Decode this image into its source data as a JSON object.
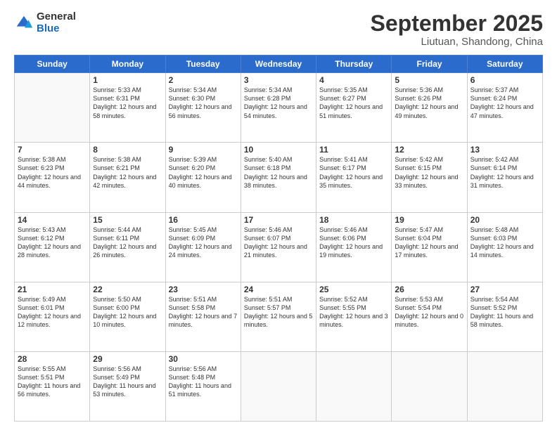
{
  "logo": {
    "general": "General",
    "blue": "Blue"
  },
  "header": {
    "month": "September 2025",
    "location": "Liutuan, Shandong, China"
  },
  "weekdays": [
    "Sunday",
    "Monday",
    "Tuesday",
    "Wednesday",
    "Thursday",
    "Friday",
    "Saturday"
  ],
  "weeks": [
    [
      {
        "day": "",
        "sunrise": "",
        "sunset": "",
        "daylight": ""
      },
      {
        "day": "1",
        "sunrise": "Sunrise: 5:33 AM",
        "sunset": "Sunset: 6:31 PM",
        "daylight": "Daylight: 12 hours and 58 minutes."
      },
      {
        "day": "2",
        "sunrise": "Sunrise: 5:34 AM",
        "sunset": "Sunset: 6:30 PM",
        "daylight": "Daylight: 12 hours and 56 minutes."
      },
      {
        "day": "3",
        "sunrise": "Sunrise: 5:34 AM",
        "sunset": "Sunset: 6:28 PM",
        "daylight": "Daylight: 12 hours and 54 minutes."
      },
      {
        "day": "4",
        "sunrise": "Sunrise: 5:35 AM",
        "sunset": "Sunset: 6:27 PM",
        "daylight": "Daylight: 12 hours and 51 minutes."
      },
      {
        "day": "5",
        "sunrise": "Sunrise: 5:36 AM",
        "sunset": "Sunset: 6:26 PM",
        "daylight": "Daylight: 12 hours and 49 minutes."
      },
      {
        "day": "6",
        "sunrise": "Sunrise: 5:37 AM",
        "sunset": "Sunset: 6:24 PM",
        "daylight": "Daylight: 12 hours and 47 minutes."
      }
    ],
    [
      {
        "day": "7",
        "sunrise": "Sunrise: 5:38 AM",
        "sunset": "Sunset: 6:23 PM",
        "daylight": "Daylight: 12 hours and 44 minutes."
      },
      {
        "day": "8",
        "sunrise": "Sunrise: 5:38 AM",
        "sunset": "Sunset: 6:21 PM",
        "daylight": "Daylight: 12 hours and 42 minutes."
      },
      {
        "day": "9",
        "sunrise": "Sunrise: 5:39 AM",
        "sunset": "Sunset: 6:20 PM",
        "daylight": "Daylight: 12 hours and 40 minutes."
      },
      {
        "day": "10",
        "sunrise": "Sunrise: 5:40 AM",
        "sunset": "Sunset: 6:18 PM",
        "daylight": "Daylight: 12 hours and 38 minutes."
      },
      {
        "day": "11",
        "sunrise": "Sunrise: 5:41 AM",
        "sunset": "Sunset: 6:17 PM",
        "daylight": "Daylight: 12 hours and 35 minutes."
      },
      {
        "day": "12",
        "sunrise": "Sunrise: 5:42 AM",
        "sunset": "Sunset: 6:15 PM",
        "daylight": "Daylight: 12 hours and 33 minutes."
      },
      {
        "day": "13",
        "sunrise": "Sunrise: 5:42 AM",
        "sunset": "Sunset: 6:14 PM",
        "daylight": "Daylight: 12 hours and 31 minutes."
      }
    ],
    [
      {
        "day": "14",
        "sunrise": "Sunrise: 5:43 AM",
        "sunset": "Sunset: 6:12 PM",
        "daylight": "Daylight: 12 hours and 28 minutes."
      },
      {
        "day": "15",
        "sunrise": "Sunrise: 5:44 AM",
        "sunset": "Sunset: 6:11 PM",
        "daylight": "Daylight: 12 hours and 26 minutes."
      },
      {
        "day": "16",
        "sunrise": "Sunrise: 5:45 AM",
        "sunset": "Sunset: 6:09 PM",
        "daylight": "Daylight: 12 hours and 24 minutes."
      },
      {
        "day": "17",
        "sunrise": "Sunrise: 5:46 AM",
        "sunset": "Sunset: 6:07 PM",
        "daylight": "Daylight: 12 hours and 21 minutes."
      },
      {
        "day": "18",
        "sunrise": "Sunrise: 5:46 AM",
        "sunset": "Sunset: 6:06 PM",
        "daylight": "Daylight: 12 hours and 19 minutes."
      },
      {
        "day": "19",
        "sunrise": "Sunrise: 5:47 AM",
        "sunset": "Sunset: 6:04 PM",
        "daylight": "Daylight: 12 hours and 17 minutes."
      },
      {
        "day": "20",
        "sunrise": "Sunrise: 5:48 AM",
        "sunset": "Sunset: 6:03 PM",
        "daylight": "Daylight: 12 hours and 14 minutes."
      }
    ],
    [
      {
        "day": "21",
        "sunrise": "Sunrise: 5:49 AM",
        "sunset": "Sunset: 6:01 PM",
        "daylight": "Daylight: 12 hours and 12 minutes."
      },
      {
        "day": "22",
        "sunrise": "Sunrise: 5:50 AM",
        "sunset": "Sunset: 6:00 PM",
        "daylight": "Daylight: 12 hours and 10 minutes."
      },
      {
        "day": "23",
        "sunrise": "Sunrise: 5:51 AM",
        "sunset": "Sunset: 5:58 PM",
        "daylight": "Daylight: 12 hours and 7 minutes."
      },
      {
        "day": "24",
        "sunrise": "Sunrise: 5:51 AM",
        "sunset": "Sunset: 5:57 PM",
        "daylight": "Daylight: 12 hours and 5 minutes."
      },
      {
        "day": "25",
        "sunrise": "Sunrise: 5:52 AM",
        "sunset": "Sunset: 5:55 PM",
        "daylight": "Daylight: 12 hours and 3 minutes."
      },
      {
        "day": "26",
        "sunrise": "Sunrise: 5:53 AM",
        "sunset": "Sunset: 5:54 PM",
        "daylight": "Daylight: 12 hours and 0 minutes."
      },
      {
        "day": "27",
        "sunrise": "Sunrise: 5:54 AM",
        "sunset": "Sunset: 5:52 PM",
        "daylight": "Daylight: 11 hours and 58 minutes."
      }
    ],
    [
      {
        "day": "28",
        "sunrise": "Sunrise: 5:55 AM",
        "sunset": "Sunset: 5:51 PM",
        "daylight": "Daylight: 11 hours and 56 minutes."
      },
      {
        "day": "29",
        "sunrise": "Sunrise: 5:56 AM",
        "sunset": "Sunset: 5:49 PM",
        "daylight": "Daylight: 11 hours and 53 minutes."
      },
      {
        "day": "30",
        "sunrise": "Sunrise: 5:56 AM",
        "sunset": "Sunset: 5:48 PM",
        "daylight": "Daylight: 11 hours and 51 minutes."
      },
      {
        "day": "",
        "sunrise": "",
        "sunset": "",
        "daylight": ""
      },
      {
        "day": "",
        "sunrise": "",
        "sunset": "",
        "daylight": ""
      },
      {
        "day": "",
        "sunrise": "",
        "sunset": "",
        "daylight": ""
      },
      {
        "day": "",
        "sunrise": "",
        "sunset": "",
        "daylight": ""
      }
    ]
  ]
}
